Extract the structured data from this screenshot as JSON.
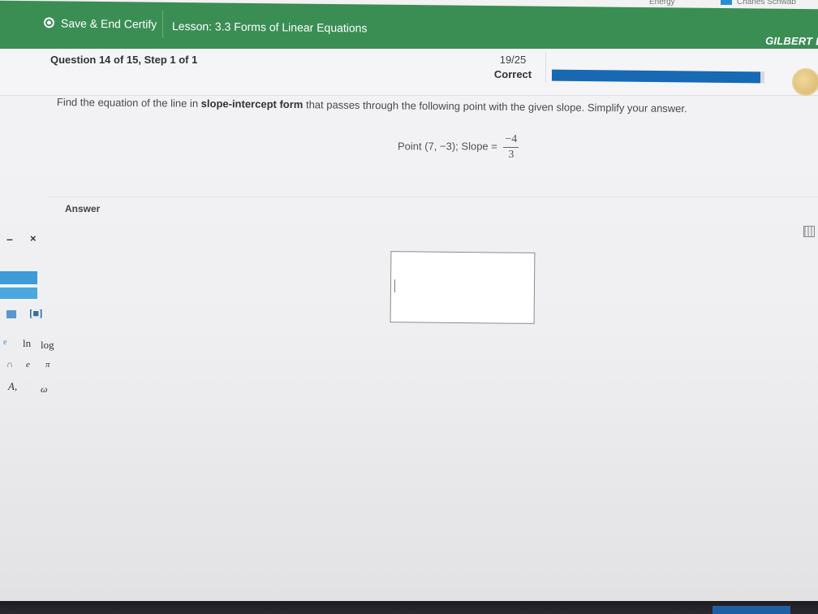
{
  "browser": {
    "bookmark_energy": "Energy",
    "bookmark_schwab": "Charles Schwab"
  },
  "topbar": {
    "save_end_label": "Save & End Certify",
    "lesson_title": "Lesson: 3.3 Forms of Linear Equations",
    "user_name": "GILBERT E"
  },
  "question_header": {
    "label": "Question 14 of 15, Step 1 of 1",
    "score": "19/25",
    "status": "Correct",
    "progress_fraction": 0.98,
    "progress_color": "#1769b4"
  },
  "question": {
    "prompt_before": "Find the equation of the line in ",
    "prompt_bold": "slope-intercept form",
    "prompt_after": " that passes through the following point with the given slope. Simplify your answer.",
    "point_text": "Point (7, −3); Slope =",
    "slope_numerator": "−4",
    "slope_denominator": "3"
  },
  "answer": {
    "label": "Answer",
    "value": ""
  },
  "palette": {
    "minimize": "–",
    "close": "×",
    "key_bracket": "[■]",
    "key_e": "e",
    "key_ln": "ln",
    "key_log": "log",
    "key_cap": "∩",
    "key_e2": "e",
    "key_pi": "π",
    "key_A": "A,",
    "key_omega": "ω"
  },
  "colors": {
    "topbar_green": "#3a8e54",
    "palette_blue": "#3e9ad8"
  }
}
